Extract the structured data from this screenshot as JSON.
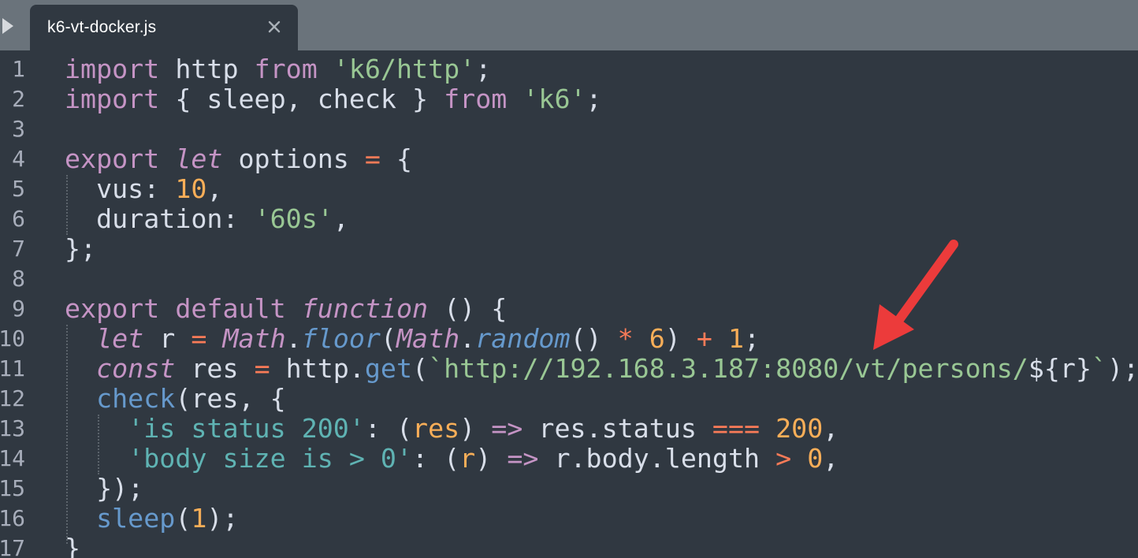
{
  "tab": {
    "title": "k6-vt-docker.js"
  },
  "icons": {
    "sidebar_toggle": "play-triangle-icon",
    "close": "close-icon",
    "annotation": "red-arrow"
  },
  "colors": {
    "background": "#303841",
    "tabbar": "#6a737b",
    "keyword": "#c594c5",
    "string": "#99c794",
    "number": "#f9ae58",
    "operator": "#f97b58",
    "function": "#6699cc",
    "arrow": "#ec3b3b"
  },
  "code": {
    "line_numbers": [
      "1",
      "2",
      "3",
      "4",
      "5",
      "6",
      "7",
      "8",
      "9",
      "10",
      "11",
      "12",
      "13",
      "14",
      "15",
      "16",
      "17"
    ],
    "lines": [
      [
        [
          "kw",
          "import"
        ],
        [
          "plain",
          " http "
        ],
        [
          "kw",
          "from"
        ],
        [
          "plain",
          " "
        ],
        [
          "str",
          "'k6/http'"
        ],
        [
          "plain",
          ";"
        ]
      ],
      [
        [
          "kw",
          "import"
        ],
        [
          "plain",
          " { sleep, check } "
        ],
        [
          "kw",
          "from"
        ],
        [
          "plain",
          " "
        ],
        [
          "str",
          "'k6'"
        ],
        [
          "plain",
          ";"
        ]
      ],
      [],
      [
        [
          "kw",
          "export"
        ],
        [
          "plain",
          " "
        ],
        [
          "it",
          "let"
        ],
        [
          "plain",
          " options "
        ],
        [
          "op",
          "="
        ],
        [
          "plain",
          " {"
        ]
      ],
      [
        [
          "plain",
          "  vus: "
        ],
        [
          "num",
          "10"
        ],
        [
          "plain",
          ","
        ]
      ],
      [
        [
          "plain",
          "  duration: "
        ],
        [
          "str",
          "'60s'"
        ],
        [
          "plain",
          ","
        ]
      ],
      [
        [
          "plain",
          "};"
        ]
      ],
      [],
      [
        [
          "kw",
          "export"
        ],
        [
          "plain",
          " "
        ],
        [
          "kw",
          "default"
        ],
        [
          "plain",
          " "
        ],
        [
          "it",
          "function"
        ],
        [
          "plain",
          " () {"
        ]
      ],
      [
        [
          "plain",
          "  "
        ],
        [
          "it",
          "let"
        ],
        [
          "plain",
          " r "
        ],
        [
          "op",
          "="
        ],
        [
          "plain",
          " "
        ],
        [
          "it",
          "Math"
        ],
        [
          "plain",
          "."
        ],
        [
          "fni",
          "floor"
        ],
        [
          "plain",
          "("
        ],
        [
          "it",
          "Math"
        ],
        [
          "plain",
          "."
        ],
        [
          "fni",
          "random"
        ],
        [
          "plain",
          "() "
        ],
        [
          "op",
          "*"
        ],
        [
          "plain",
          " "
        ],
        [
          "num",
          "6"
        ],
        [
          "plain",
          ") "
        ],
        [
          "op",
          "+"
        ],
        [
          "plain",
          " "
        ],
        [
          "num",
          "1"
        ],
        [
          "plain",
          ";"
        ]
      ],
      [
        [
          "plain",
          "  "
        ],
        [
          "it",
          "const"
        ],
        [
          "plain",
          " res "
        ],
        [
          "op",
          "="
        ],
        [
          "plain",
          " http."
        ],
        [
          "fn",
          "get"
        ],
        [
          "plain",
          "("
        ],
        [
          "str",
          "`http://192.168.3.187:8080/vt/persons/"
        ],
        [
          "plain",
          "${r}"
        ],
        [
          "str",
          "`"
        ],
        [
          "plain",
          ");"
        ]
      ],
      [
        [
          "plain",
          "  "
        ],
        [
          "fn",
          "check"
        ],
        [
          "plain",
          "(res, {"
        ]
      ],
      [
        [
          "plain",
          "    "
        ],
        [
          "str2",
          "'is status 200'"
        ],
        [
          "plain",
          ": ("
        ],
        [
          "param",
          "res"
        ],
        [
          "plain",
          ") "
        ],
        [
          "kw",
          "=>"
        ],
        [
          "plain",
          " res.status "
        ],
        [
          "op",
          "==="
        ],
        [
          "plain",
          " "
        ],
        [
          "num",
          "200"
        ],
        [
          "plain",
          ","
        ]
      ],
      [
        [
          "plain",
          "    "
        ],
        [
          "str2",
          "'body size is > 0'"
        ],
        [
          "plain",
          ": ("
        ],
        [
          "param",
          "r"
        ],
        [
          "plain",
          ") "
        ],
        [
          "kw",
          "=>"
        ],
        [
          "plain",
          " r.body.length "
        ],
        [
          "op",
          ">"
        ],
        [
          "plain",
          " "
        ],
        [
          "num",
          "0"
        ],
        [
          "plain",
          ","
        ]
      ],
      [
        [
          "plain",
          "  });"
        ]
      ],
      [
        [
          "plain",
          "  "
        ],
        [
          "fn",
          "sleep"
        ],
        [
          "plain",
          "("
        ],
        [
          "num",
          "1"
        ],
        [
          "plain",
          ");"
        ]
      ],
      [
        [
          "plain",
          "}"
        ]
      ]
    ]
  }
}
